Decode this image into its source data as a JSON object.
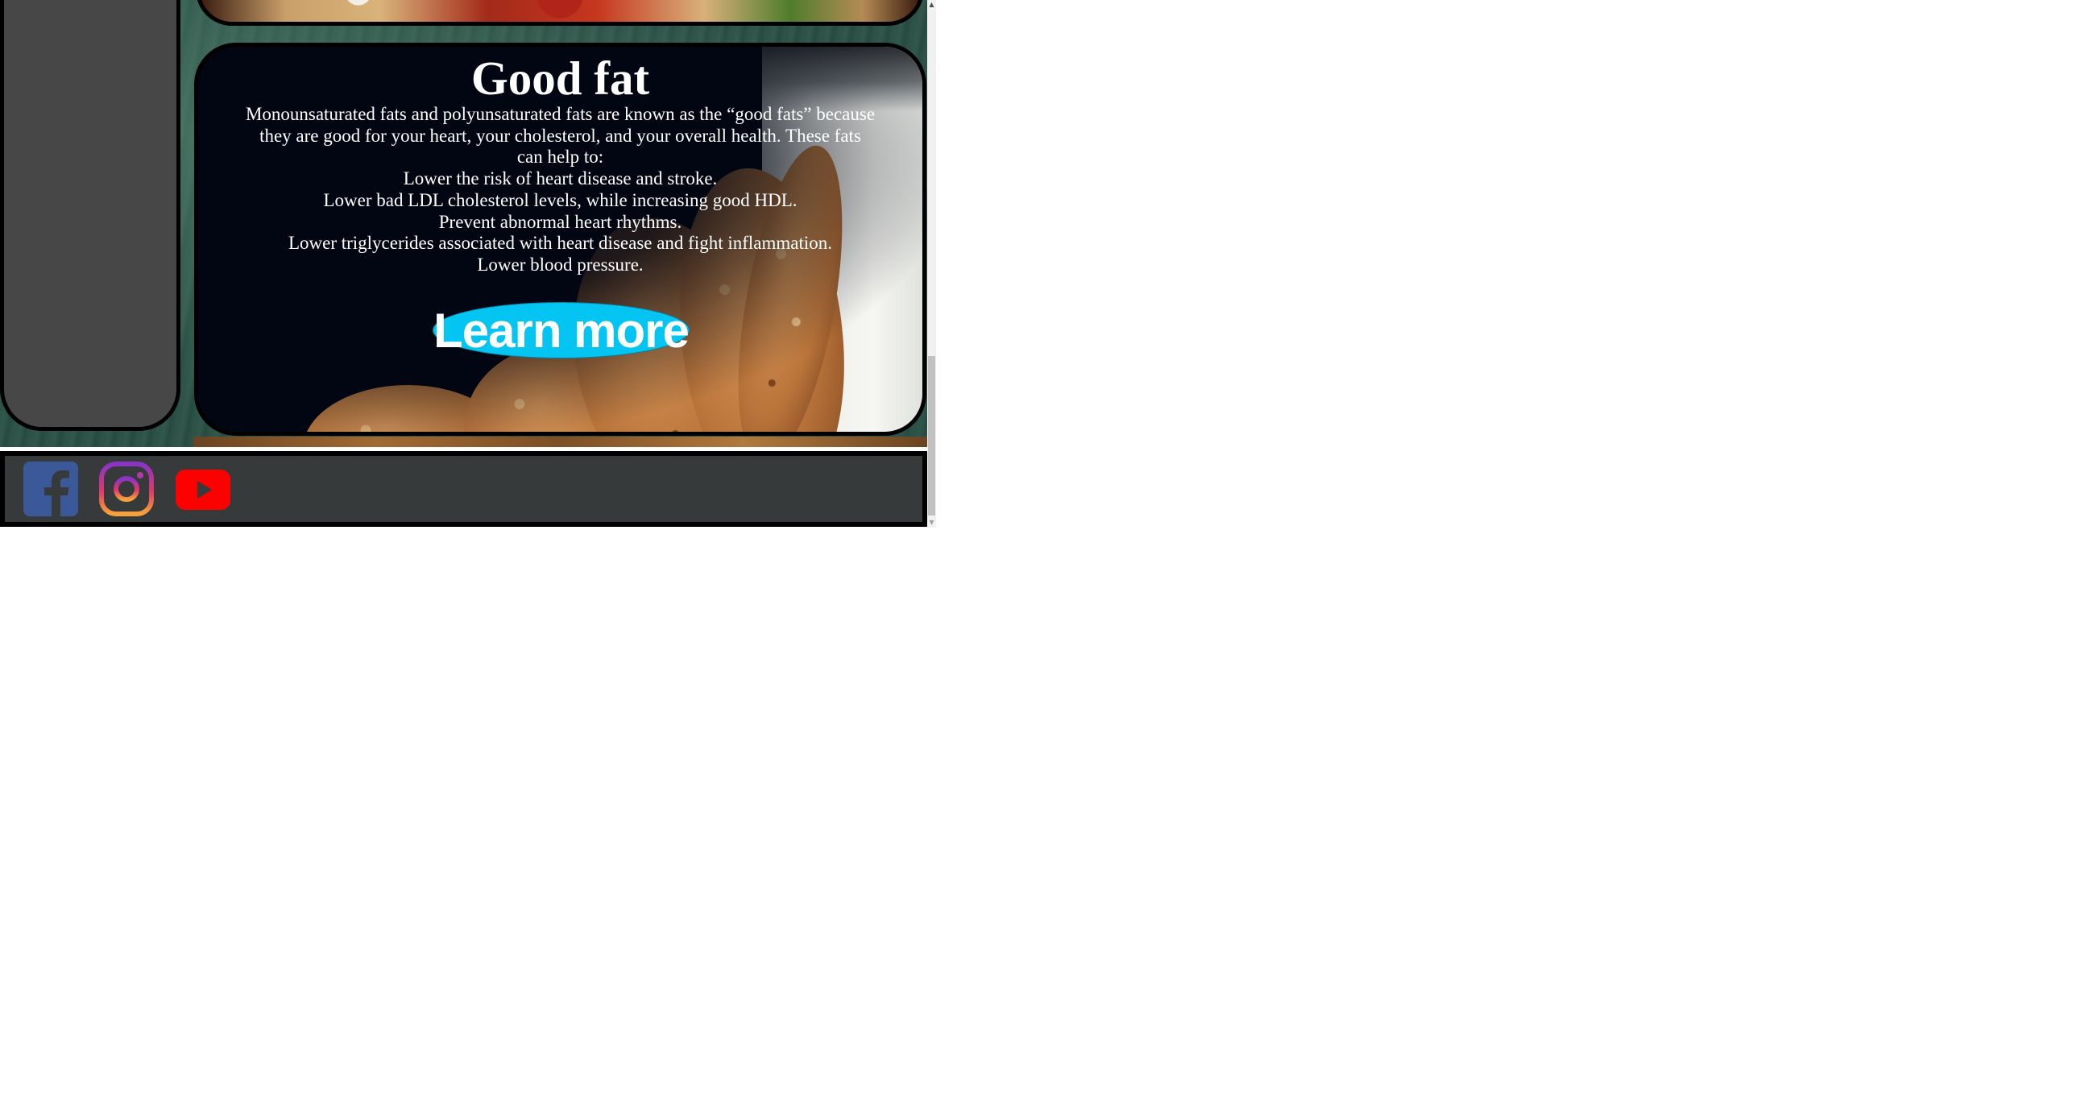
{
  "card": {
    "title": "Good fat",
    "body_lines": [
      "Monounsaturated fats and polyunsaturated fats are known as the “good fats” because",
      "they are good for your heart, your cholesterol, and your overall health. These fats",
      "can help to:",
      "Lower the risk of heart disease and stroke.",
      "Lower bad LDL cholesterol levels, while increasing good HDL.",
      "Prevent abnormal heart rhythms.",
      "Lower triglycerides associated with heart disease and fight inflammation.",
      "Lower blood pressure."
    ],
    "button_label": "Learn more",
    "button_color": "#04c4f2"
  },
  "footer": {
    "social_icons": [
      "facebook-icon",
      "instagram-icon",
      "youtube-icon"
    ],
    "background": "#373a3b"
  },
  "scrollbar": {
    "up_arrow": "▲",
    "down_arrow": "▼"
  }
}
